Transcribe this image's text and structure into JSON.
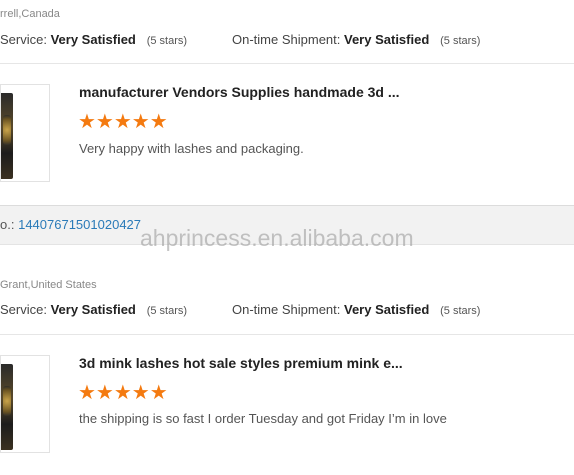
{
  "reviews": [
    {
      "location": "rrell,Canada",
      "service_label": "Service:",
      "service_value": "Very Satisfied",
      "service_stars": "(5 stars)",
      "shipment_label": "On-time Shipment:",
      "shipment_value": "Very Satisfied",
      "shipment_stars": "(5 stars)",
      "product_title": "manufacturer Vendors Supplies handmade 3d ...",
      "rating": 5,
      "stars_glyphs": "★★★★★",
      "comment": "Very happy with lashes and packaging."
    },
    {
      "location": "Grant,United States",
      "service_label": "Service:",
      "service_value": "Very Satisfied",
      "service_stars": "(5 stars)",
      "shipment_label": "On-time Shipment:",
      "shipment_value": "Very Satisfied",
      "shipment_stars": "(5 stars)",
      "product_title": "3d mink lashes hot sale styles premium mink e...",
      "rating": 5,
      "stars_glyphs": "★★★★★",
      "comment": "the shipping is so fast I order Tuesday and got Friday I’m in love"
    }
  ],
  "order_bar": {
    "prefix": "o.:",
    "order_number": "1440767150102042​7"
  },
  "watermark": "ahprincess.en.alibaba.com",
  "colors": {
    "star": "#f47a10",
    "link": "#2a7ab8",
    "order_bar_bg": "#f2f2f2"
  }
}
